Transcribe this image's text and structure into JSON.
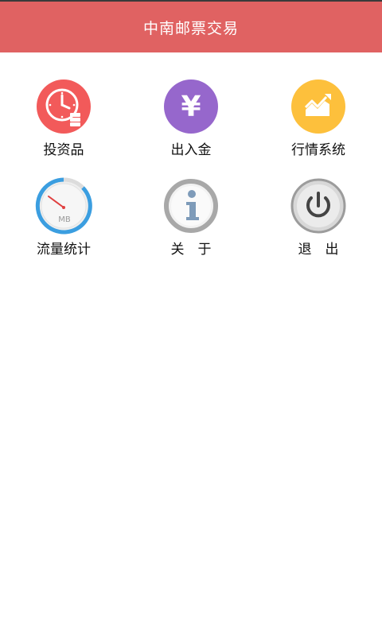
{
  "header": {
    "title": "中南邮票交易"
  },
  "menu": {
    "items": [
      {
        "label": "投资品",
        "icon": "clock-icon"
      },
      {
        "label": "出入金",
        "icon": "yen-icon"
      },
      {
        "label": "行情系统",
        "icon": "chart-trend-icon"
      },
      {
        "label": "流量统计",
        "icon": "gauge-icon",
        "gauge_text": "MB"
      },
      {
        "label": "关　于",
        "icon": "info-icon"
      },
      {
        "label": "退　出",
        "icon": "power-icon"
      }
    ]
  },
  "colors": {
    "header": "#e06262",
    "clock": "#f25a5a",
    "yen": "#9667cc",
    "chart": "#fdc03c",
    "gauge_ring": "#3b9ee0"
  }
}
